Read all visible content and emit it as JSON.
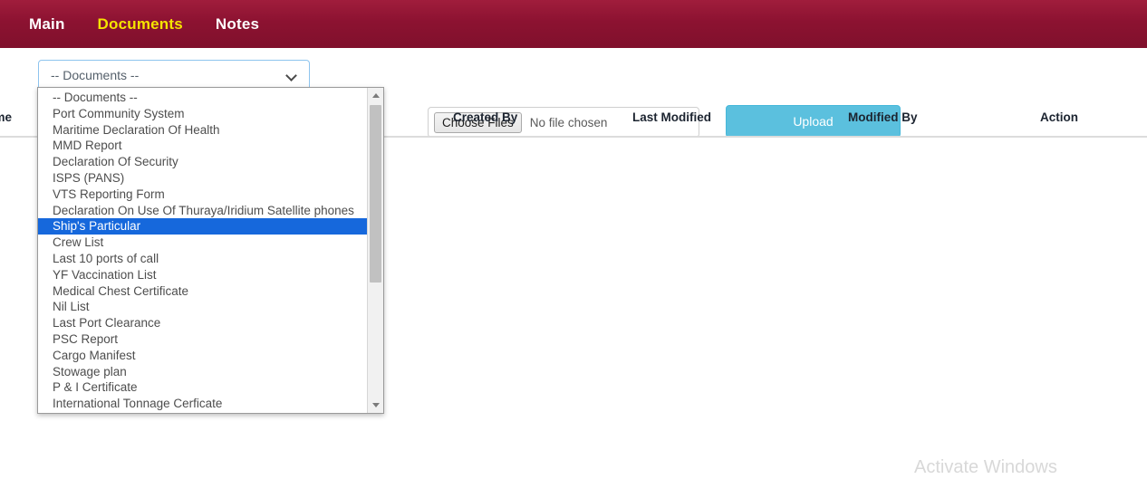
{
  "navbar": {
    "items": [
      {
        "label": "Main",
        "active": false
      },
      {
        "label": "Documents",
        "active": true
      },
      {
        "label": "Notes",
        "active": false
      }
    ],
    "background_color": "#8c1231",
    "active_color": "#f5e400",
    "inactive_color": "#ffffff"
  },
  "toolbar": {
    "document_select": {
      "selected_value": "-- Documents --",
      "icon": "chevron-down-icon",
      "focus_border_color": "#8ec4ee"
    },
    "file_input": {
      "button_label": "Choose Files",
      "status_text": "No file chosen"
    },
    "upload_button": {
      "label": "Upload",
      "background_color": "#5bc0de",
      "text_color": "#ffffff"
    }
  },
  "table": {
    "headers": [
      {
        "label": "ame",
        "key": "name",
        "truncated": true
      },
      {
        "label": "Created By",
        "key": "created_by",
        "truncated": false
      },
      {
        "label": "Last Modified",
        "key": "last_modified",
        "truncated": false
      },
      {
        "label": "Modified By",
        "key": "modified_by",
        "truncated": false
      },
      {
        "label": "Action",
        "key": "action",
        "truncated": false
      }
    ],
    "rows": []
  },
  "dropdown": {
    "open": true,
    "selected_index": 8,
    "highlight_color": "#1668dc",
    "scrollbar": {
      "up_icon": "triangle-up-icon",
      "down_icon": "triangle-down-icon"
    },
    "options": [
      "-- Documents --",
      "Port Community System",
      "Maritime Declaration Of Health",
      "MMD Report",
      "Declaration Of Security",
      "ISPS (PANS)",
      "VTS Reporting Form",
      "Declaration On Use Of Thuraya/Iridium Satellite phones",
      "Ship's Particular",
      "Crew List",
      "Last 10 ports of call",
      "YF Vaccination List",
      "Medical Chest Certificate",
      "Nil List",
      "Last Port Clearance",
      "PSC Report",
      "Cargo Manifest",
      "Stowage plan",
      "P & I Certificate",
      "International Tonnage Cerficate"
    ]
  },
  "watermark": {
    "text": "Activate Windows"
  }
}
